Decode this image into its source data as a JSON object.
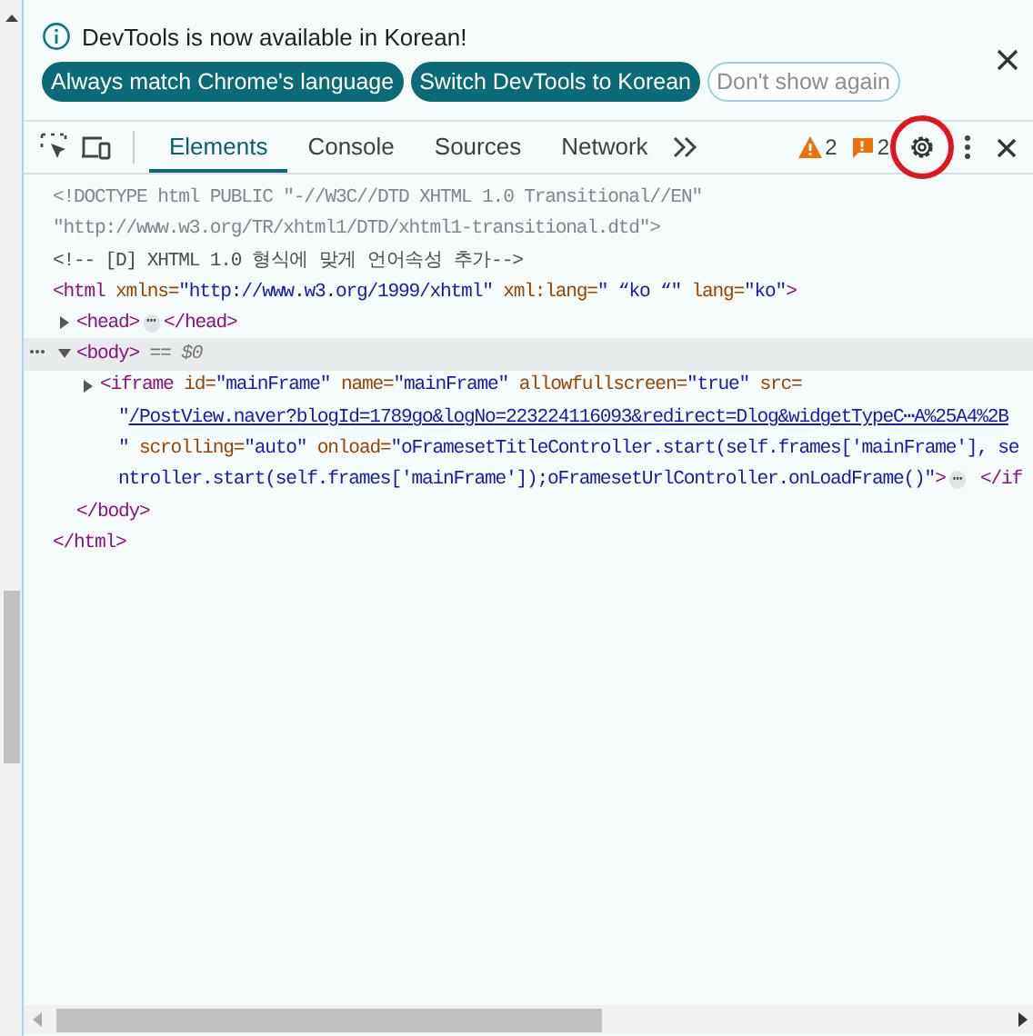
{
  "infobar": {
    "message": "DevTools is now available in Korean!",
    "buttons": [
      {
        "label": "Always match Chrome's language",
        "kind": "filled"
      },
      {
        "label": "Switch DevTools to Korean",
        "kind": "filled"
      },
      {
        "label": "Don't show again",
        "kind": "outlined"
      }
    ]
  },
  "toolbar": {
    "tabs": [
      {
        "label": "Elements",
        "selected": true
      },
      {
        "label": "Console",
        "selected": false
      },
      {
        "label": "Sources",
        "selected": false
      },
      {
        "label": "Network",
        "selected": false
      }
    ],
    "warnings": "2",
    "issues": "2"
  },
  "dom": [
    {
      "lines": [
        [
          {
            "kind": "doctype",
            "text": "<!DOCTYPE html PUBLIC \"-//W3C//DTD XHTML 1.0 Transitional//EN\""
          }
        ],
        [
          {
            "kind": "doctype",
            "text": "\"http://www.w3.org/TR/xhtml1/DTD/xhtml1-transitional.dtd\">"
          }
        ]
      ]
    },
    {
      "lines": [
        [
          {
            "kind": "comment",
            "text": "<!-- [D] XHTML 1.0 형식에 맞게 언어속성 추가-->"
          }
        ]
      ]
    },
    {
      "lines": [
        [
          {
            "kind": "tag",
            "text": "<html"
          },
          {
            "kind": "attr",
            "text": " xmlns="
          },
          {
            "kind": "value",
            "text": "\"http://www.w3.org/1999/xhtml\""
          },
          {
            "kind": "attr",
            "text": " xml:lang="
          },
          {
            "kind": "value",
            "text": "\" “ko “\""
          },
          {
            "kind": "attr",
            "text": " lang="
          },
          {
            "kind": "value",
            "text": "\"ko\""
          },
          {
            "kind": "tag",
            "text": ">"
          }
        ]
      ],
      "children": [
        {
          "expanded": false,
          "selected": false,
          "lines": [
            [
              {
                "kind": "tag",
                "text": "<head>"
              },
              {
                "kind": "ellipsis",
                "text": "⋯"
              },
              {
                "kind": "tag",
                "text": "</head>"
              }
            ]
          ]
        },
        {
          "expanded": true,
          "selected": true,
          "lines": [
            [
              {
                "kind": "tag",
                "text": "<body>"
              },
              {
                "kind": "ref",
                "text": " == $0"
              }
            ]
          ],
          "children": [
            {
              "expanded": false,
              "selected": false,
              "lines": [
                [
                  {
                    "kind": "tag",
                    "text": "<iframe"
                  },
                  {
                    "kind": "attr",
                    "text": " id="
                  },
                  {
                    "kind": "value",
                    "text": "\"mainFrame\""
                  },
                  {
                    "kind": "attr",
                    "text": " name="
                  },
                  {
                    "kind": "value",
                    "text": "\"mainFrame\""
                  },
                  {
                    "kind": "attr",
                    "text": " allowfullscreen="
                  },
                  {
                    "kind": "value",
                    "text": "\"true\""
                  },
                  {
                    "kind": "attr",
                    "text": " src="
                  }
                ],
                [
                  {
                    "kind": "value",
                    "text": "\""
                  },
                  {
                    "kind": "link",
                    "text": "/PostView.naver?blogId=1789go&logNo=223224116093&redirect=Dlog&widgetTypeC⋯A%25A4%2B"
                  }
                ],
                [
                  {
                    "kind": "value",
                    "text": "\""
                  },
                  {
                    "kind": "attr",
                    "text": " scrolling="
                  },
                  {
                    "kind": "value",
                    "text": "\"auto\""
                  },
                  {
                    "kind": "attr",
                    "text": " onload="
                  },
                  {
                    "kind": "value",
                    "text": "\"oFramesetTitleController.start(self.frames['mainFrame'], se"
                  }
                ],
                [
                  {
                    "kind": "value",
                    "text": "ntroller.start(self.frames['mainFrame']);oFramesetUrlController.onLoadFrame()\""
                  },
                  {
                    "kind": "tag",
                    "text": ">"
                  },
                  {
                    "kind": "ellipsis",
                    "text": "⋯"
                  },
                  {
                    "kind": "tag",
                    "text": " </if"
                  }
                ]
              ]
            }
          ],
          "closing": [
            {
              "kind": "tag",
              "text": "</body>"
            }
          ]
        }
      ],
      "closing": [
        {
          "kind": "tag",
          "text": "</html>"
        }
      ]
    }
  ]
}
